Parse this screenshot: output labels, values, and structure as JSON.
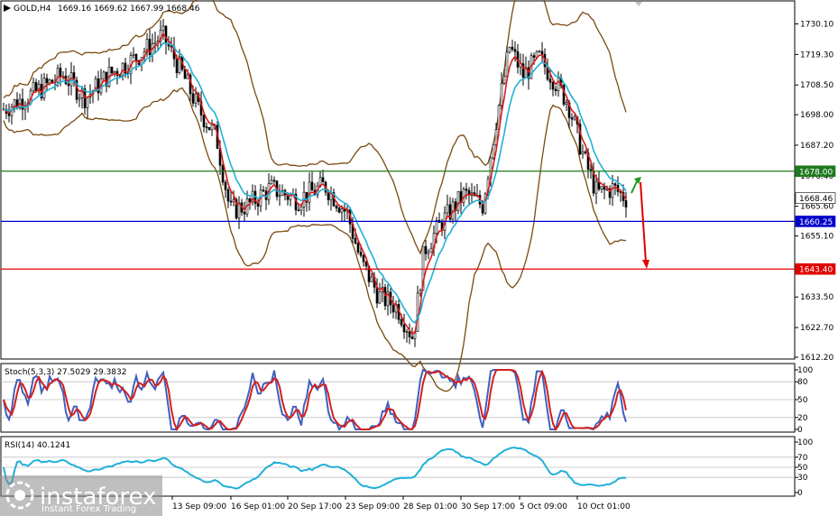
{
  "header": {
    "symbol": "GOLD,H4",
    "ohlc": "1669.16 1669.62 1667.99 1668.46"
  },
  "price_axis": {
    "ticks": [
      "1730.10",
      "1719.30",
      "1708.50",
      "1698.00",
      "1687.20",
      "1676.40",
      "1665.60",
      "1655.10",
      "1644.30",
      "1633.50",
      "1622.70",
      "1612.20"
    ],
    "range": [
      1612.2,
      1736.0
    ]
  },
  "levels": [
    {
      "value": 1678.0,
      "label": "1678.00",
      "color": "#1e7a1e"
    },
    {
      "value": 1668.46,
      "label": "1668.46",
      "color": "#ffffff",
      "text_color": "#000000"
    },
    {
      "value": 1660.25,
      "label": "1660.25",
      "color": "#0000cc"
    },
    {
      "value": 1643.4,
      "label": "1643.40",
      "color": "#e00000"
    }
  ],
  "stoch": {
    "label": "Stoch(5,3,3) 27.5029 29.3832",
    "ticks": [
      "100",
      "80",
      "50",
      "20",
      "0"
    ]
  },
  "rsi": {
    "label": "RSI(14) 40.1241",
    "ticks": [
      "100",
      "70",
      "50",
      "30",
      "0"
    ]
  },
  "time_axis": {
    "labels": [
      "13 Sep 09:00",
      "16 Sep 01:00",
      "20 Sep 17:00",
      "23 Sep 09:00",
      "28 Sep 01:00",
      "30 Sep 17:00",
      "5 Oct 09:00",
      "10 Oct 01:00"
    ]
  },
  "logo": {
    "name": "instaforex",
    "tagline": "Instant Forex Trading"
  },
  "colors": {
    "candle": "#000000",
    "ma_red": "#d42020",
    "ma_cyan": "#20b0d8",
    "bands": "#7a4a10",
    "stoch_main": "#4060c0",
    "stoch_signal": "#d42020",
    "rsi": "#20b0d8",
    "grid": "#c0c0c0"
  }
}
